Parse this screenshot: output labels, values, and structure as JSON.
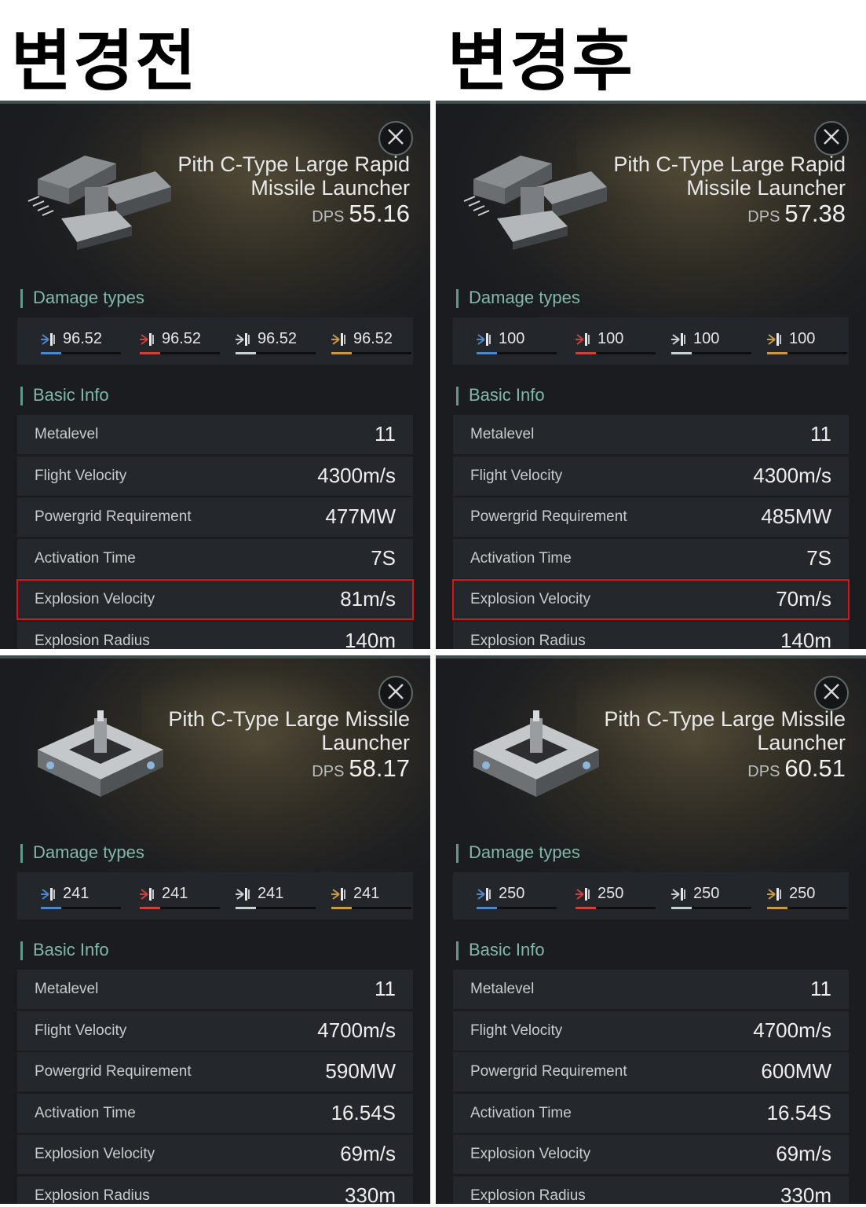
{
  "headings": {
    "before": "변경전",
    "after": "변경후"
  },
  "dps_label": "DPS",
  "sections": {
    "damage": "Damage types",
    "basic": "Basic Info"
  },
  "colors": {
    "em": "#4f86c6",
    "thermal": "#c8433d",
    "kinetic": "#c9d2d6",
    "explosive": "#c99a45",
    "highlight": "#d01818",
    "section": "#7fb9a9"
  },
  "panels": [
    {
      "title": "Pith C-Type Large Rapid Missile Launcher",
      "dps": "55.16",
      "icon": "rapid-missile-launcher-icon",
      "damage": [
        "96.52",
        "96.52",
        "96.52",
        "96.52"
      ],
      "rows": [
        {
          "k": "Metalevel",
          "v": "11"
        },
        {
          "k": "Flight Velocity",
          "v": "4300m/s"
        },
        {
          "k": "Powergrid Requirement",
          "v": "477MW"
        },
        {
          "k": "Activation Time",
          "v": "7S"
        },
        {
          "k": "Explosion Velocity",
          "v": "81m/s",
          "highlight": true
        },
        {
          "k": "Explosion Radius",
          "v": "140m"
        }
      ]
    },
    {
      "title": "Pith C-Type Large Rapid Missile Launcher",
      "dps": "57.38",
      "icon": "rapid-missile-launcher-icon",
      "damage": [
        "100",
        "100",
        "100",
        "100"
      ],
      "rows": [
        {
          "k": "Metalevel",
          "v": "11"
        },
        {
          "k": "Flight Velocity",
          "v": "4300m/s"
        },
        {
          "k": "Powergrid Requirement",
          "v": "485MW"
        },
        {
          "k": "Activation Time",
          "v": "7S"
        },
        {
          "k": "Explosion Velocity",
          "v": "70m/s",
          "highlight": true
        },
        {
          "k": "Explosion Radius",
          "v": "140m"
        }
      ]
    },
    {
      "title": "Pith C-Type Large Missile Launcher",
      "dps": "58.17",
      "icon": "missile-launcher-icon",
      "damage": [
        "241",
        "241",
        "241",
        "241"
      ],
      "rows": [
        {
          "k": "Metalevel",
          "v": "11"
        },
        {
          "k": "Flight Velocity",
          "v": "4700m/s"
        },
        {
          "k": "Powergrid Requirement",
          "v": "590MW"
        },
        {
          "k": "Activation Time",
          "v": "16.54S"
        },
        {
          "k": "Explosion Velocity",
          "v": "69m/s"
        },
        {
          "k": "Explosion Radius",
          "v": "330m"
        }
      ]
    },
    {
      "title": "Pith C-Type Large Missile Launcher",
      "dps": "60.51",
      "icon": "missile-launcher-icon",
      "damage": [
        "250",
        "250",
        "250",
        "250"
      ],
      "rows": [
        {
          "k": "Metalevel",
          "v": "11"
        },
        {
          "k": "Flight Velocity",
          "v": "4700m/s"
        },
        {
          "k": "Powergrid Requirement",
          "v": "600MW"
        },
        {
          "k": "Activation Time",
          "v": "16.54S"
        },
        {
          "k": "Explosion Velocity",
          "v": "69m/s"
        },
        {
          "k": "Explosion Radius",
          "v": "330m"
        }
      ]
    }
  ]
}
